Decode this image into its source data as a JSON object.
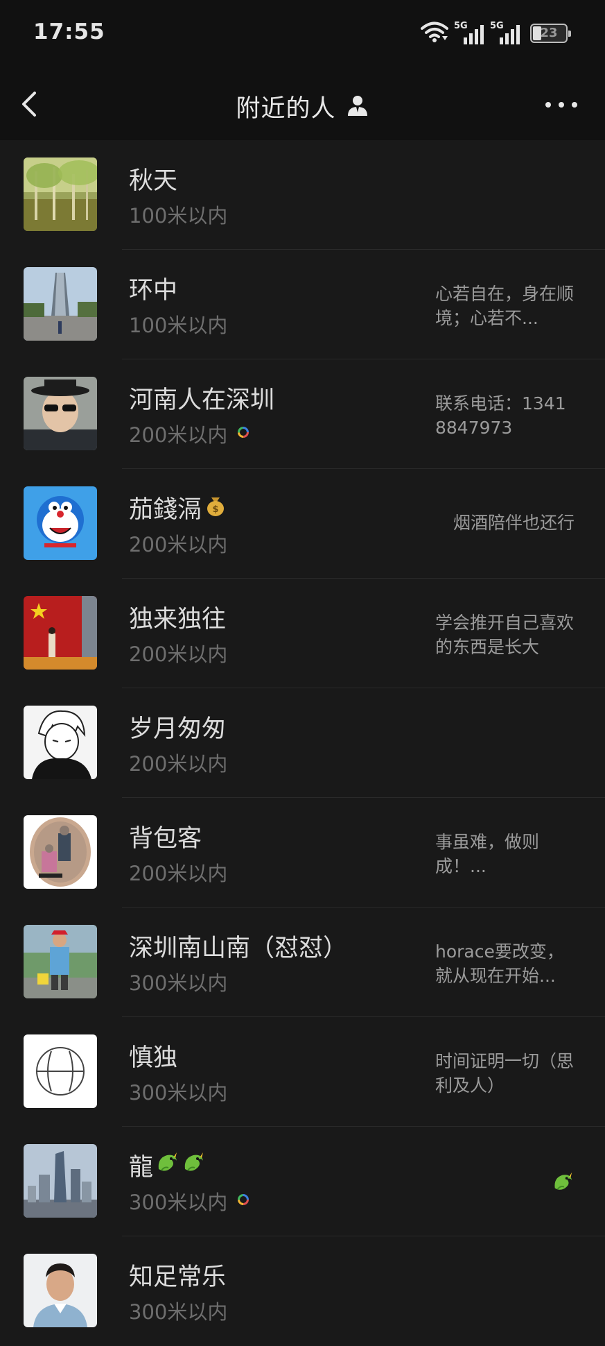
{
  "status_bar": {
    "time": "17:55",
    "network_1": "5G",
    "network_2": "5G",
    "battery_level": "23",
    "icons": [
      "wifi-icon",
      "signal-icon",
      "signal-icon",
      "battery-icon"
    ]
  },
  "nav": {
    "title": "附近的人",
    "back_icon": "chevron-left-icon",
    "title_icon": "person-icon",
    "more_icon": "more-dots-icon"
  },
  "people": [
    {
      "name": "秋天",
      "distance": "100米以内",
      "signature": ""
    },
    {
      "name": "环中",
      "distance": "100米以内",
      "signature": "心若自在，身在顺境；心若不..."
    },
    {
      "name": "河南人在深圳",
      "distance": "200米以内",
      "signature": "联系电话：13418847973",
      "badge": "status-ring-icon"
    },
    {
      "name": "茄錢滆",
      "distance": "200米以内",
      "signature": "烟酒陪伴也还行",
      "name_icon": "money-bag-icon"
    },
    {
      "name": "独来独往",
      "distance": "200米以内",
      "signature": "学会推开自己喜欢的东西是长大"
    },
    {
      "name": "岁月匆匆",
      "distance": "200米以内",
      "signature": ""
    },
    {
      "name": "背包客",
      "distance": "200米以内",
      "signature": "事虽难，做则成！..."
    },
    {
      "name": "深圳南山南（怼怼）",
      "distance": "300米以内",
      "signature": "horace要改变，就从现在开始..."
    },
    {
      "name": "慎独",
      "distance": "300米以内",
      "signature": "时间证明一切（思利及人）"
    },
    {
      "name": "龍",
      "distance": "300米以内",
      "signature": "",
      "badge": "status-ring-icon",
      "name_icon": "dragon-icon",
      "signature_icon": "dragon-icon"
    },
    {
      "name": "知足常乐",
      "distance": "300米以内",
      "signature": ""
    }
  ],
  "colors": {
    "background": "#191919",
    "header": "#111111",
    "name_text": "#dcdcdc",
    "distance_text": "#6e6e6e",
    "signature_text": "#9b9b9b",
    "divider": "#2a2a2a"
  }
}
